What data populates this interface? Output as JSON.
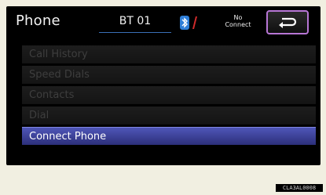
{
  "header": {
    "title": "Phone",
    "device_name": "BT 01",
    "connection_status_line1": "No",
    "connection_status_line2": "Connect"
  },
  "icons": {
    "bluetooth": "bluetooth-icon",
    "signal": "signal-strength-icon",
    "back": "back-arrow-icon"
  },
  "menu": {
    "items": [
      {
        "label": "Call History",
        "enabled": false
      },
      {
        "label": "Speed Dials",
        "enabled": false
      },
      {
        "label": "Contacts",
        "enabled": false
      },
      {
        "label": "Dial",
        "enabled": false
      },
      {
        "label": "Connect Phone",
        "enabled": true
      }
    ]
  },
  "figure_code": "CLA3AL0008",
  "colors": {
    "accent_back_border": "#b776d5",
    "bluetooth_blue": "#2f7fd8",
    "signal_red": "#d22b2b",
    "selected_item": "#3d43a0"
  }
}
